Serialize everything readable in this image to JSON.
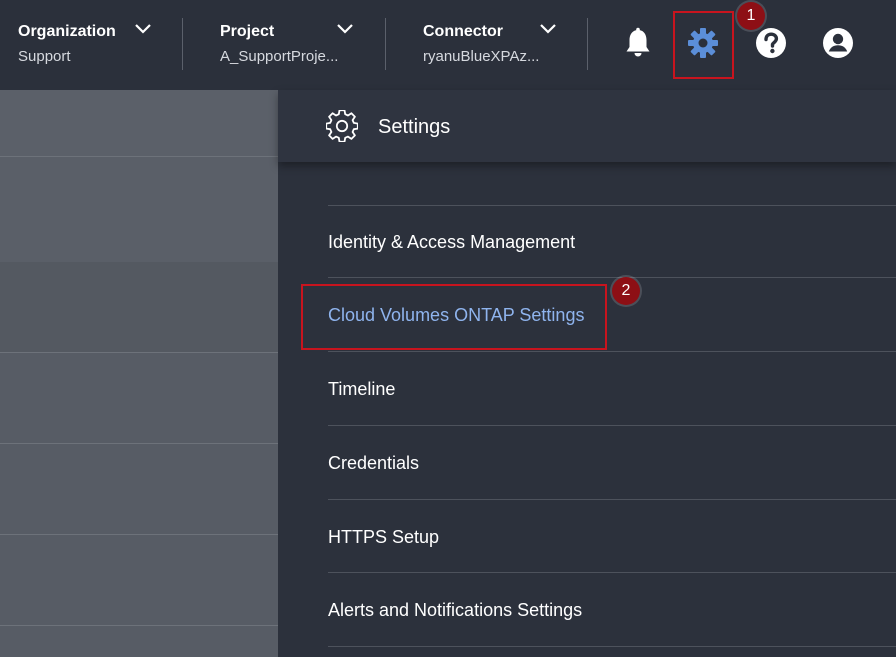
{
  "header": {
    "organization": {
      "title": "Organization",
      "value": "Support"
    },
    "project": {
      "title": "Project",
      "value": "A_SupportProje..."
    },
    "connector": {
      "title": "Connector",
      "value": "ryanuBlueXPAz..."
    },
    "icons": [
      "bell-icon",
      "gear-icon",
      "help-icon",
      "user-icon"
    ]
  },
  "callouts": {
    "first": "1",
    "second": "2"
  },
  "settings_panel": {
    "title": "Settings",
    "items": [
      {
        "label": "Identity & Access Management"
      },
      {
        "label": "Cloud Volumes ONTAP Settings",
        "active": true
      },
      {
        "label": "Timeline"
      },
      {
        "label": "Credentials"
      },
      {
        "label": "HTTPS Setup"
      },
      {
        "label": "Alerts and Notifications Settings"
      }
    ]
  },
  "colors": {
    "header_bg": "#2b303b",
    "panel_bg": "#2c313c",
    "active_link": "#8fb4ee",
    "active_icon": "#5b8ed8",
    "callout": "#c8141e"
  }
}
